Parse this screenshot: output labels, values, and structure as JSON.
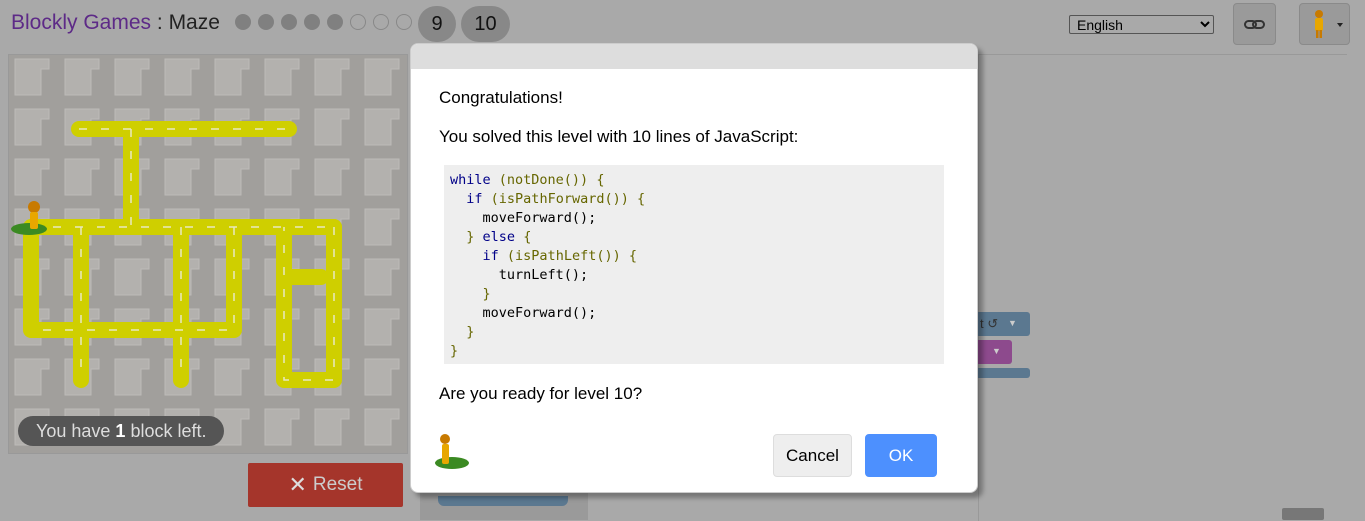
{
  "header": {
    "brand": "Blockly Games",
    "separator": " : ",
    "game": "Maze",
    "levels_done": 5,
    "levels_open": 3,
    "current_level": "9",
    "next_level": "10",
    "language": "English"
  },
  "maze": {
    "blocks_left_prefix": "You have ",
    "blocks_left_count": "1",
    "blocks_left_suffix": " block left.",
    "reset_label": "Reset"
  },
  "dialog": {
    "congrats": "Congratulations!",
    "solved": "You solved this level with 10 lines of JavaScript:",
    "code": [
      "while (notDone()) {",
      "  if (isPathForward()) {",
      "    moveForward();",
      "  } else {",
      "    if (isPathLeft()) {",
      "      turnLeft();",
      "    }",
      "    moveForward();",
      "  }",
      "}"
    ],
    "ready": "Are you ready for level 10?",
    "cancel_label": "Cancel",
    "ok_label": "OK"
  },
  "workspace": {
    "visible_fragment": "t ↺"
  },
  "colors": {
    "path": "#d5d500",
    "reset": "#a5352b",
    "ok": "#4d90fe",
    "brand": "#5d2a87"
  }
}
